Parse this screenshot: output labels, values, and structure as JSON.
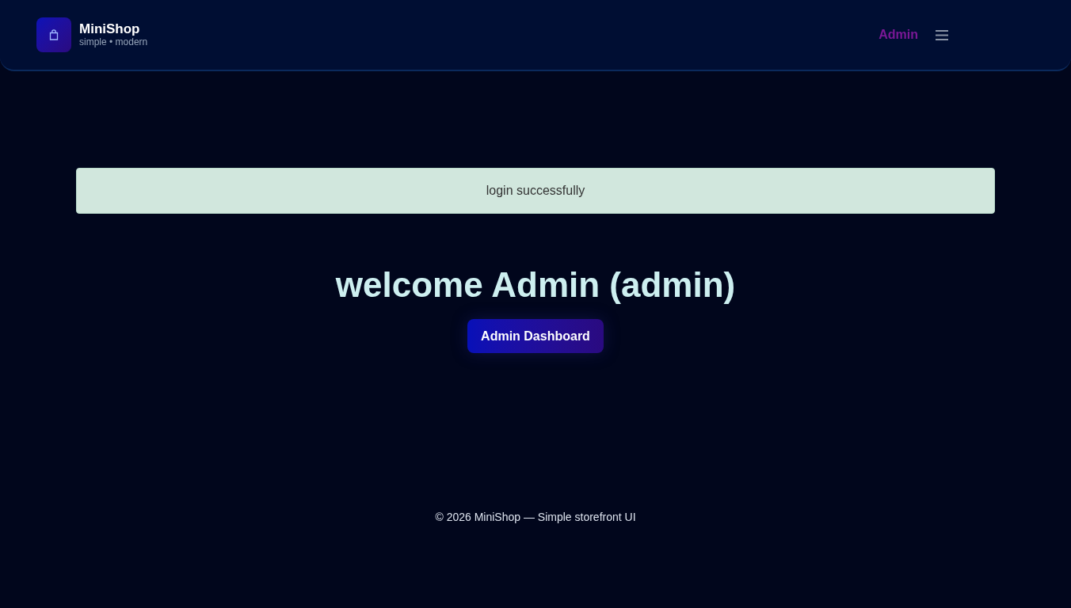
{
  "brand": {
    "name": "MiniShop",
    "tagline": "simple • modern"
  },
  "nav": {
    "user_link": "Admin"
  },
  "alert": {
    "message": "login successfully"
  },
  "heading": "welcome Admin (admin)",
  "dashboard_button": "Admin Dashboard",
  "footer": "© 2026 MiniShop — Simple storefront UI"
}
